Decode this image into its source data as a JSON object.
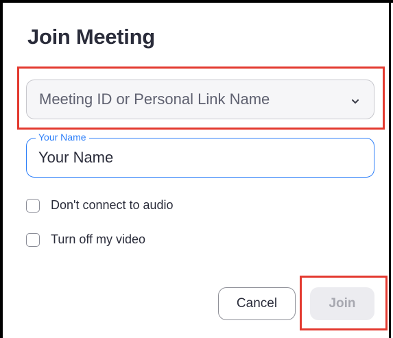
{
  "dialog": {
    "title": "Join Meeting"
  },
  "meeting_id": {
    "placeholder": "Meeting ID or Personal Link Name",
    "icon": "chevron-down-icon"
  },
  "your_name": {
    "label": "Your Name",
    "placeholder": "Your Name",
    "value": ""
  },
  "options": {
    "no_audio_label": "Don't connect to audio",
    "no_audio_checked": false,
    "no_video_label": "Turn off my video",
    "no_video_checked": false
  },
  "buttons": {
    "cancel_label": "Cancel",
    "join_label": "Join",
    "join_enabled": false
  },
  "colors": {
    "accent": "#2d7ff9",
    "highlight": "#e3392f",
    "text": "#2a2c3a"
  }
}
